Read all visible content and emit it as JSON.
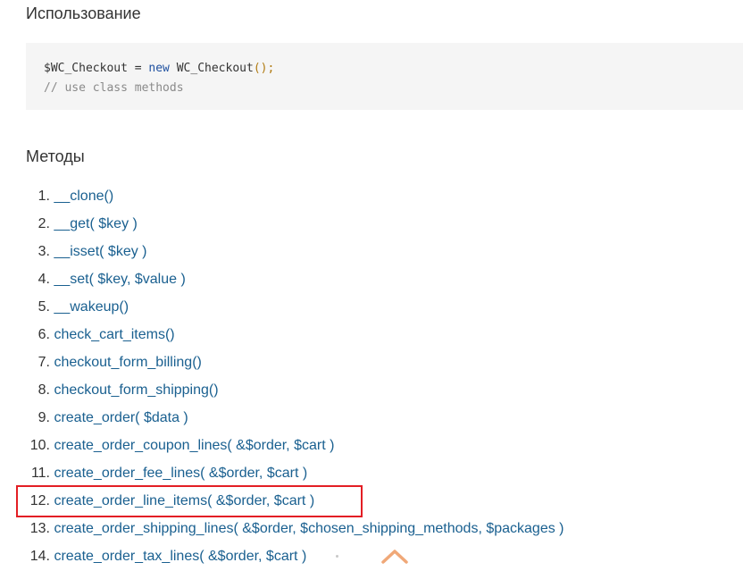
{
  "usage": {
    "title": "Использование",
    "code": {
      "line1": {
        "var": "$WC_Checkout",
        "op": " = ",
        "keyword": "new",
        "space": " ",
        "class": "WC_Checkout",
        "parens": "();"
      },
      "line2": "// use class methods"
    }
  },
  "methods": {
    "title": "Методы",
    "items": [
      {
        "num": "1.",
        "label": "__clone()"
      },
      {
        "num": "2.",
        "label": "__get( $key )"
      },
      {
        "num": "3.",
        "label": "__isset( $key )"
      },
      {
        "num": "4.",
        "label": "__set( $key, $value )"
      },
      {
        "num": "5.",
        "label": "__wakeup()"
      },
      {
        "num": "6.",
        "label": "check_cart_items()"
      },
      {
        "num": "7.",
        "label": "checkout_form_billing()"
      },
      {
        "num": "8.",
        "label": "checkout_form_shipping()"
      },
      {
        "num": "9.",
        "label": "create_order( $data )"
      },
      {
        "num": "10.",
        "label": "create_order_coupon_lines( &$order, $cart )"
      },
      {
        "num": "11.",
        "label": "create_order_fee_lines( &$order, $cart )"
      },
      {
        "num": "12.",
        "label": "create_order_line_items( &$order, $cart )"
      },
      {
        "num": "13.",
        "label": "create_order_shipping_lines( &$order, $chosen_shipping_methods, $packages )"
      },
      {
        "num": "14.",
        "label": "create_order_tax_lines( &$order, $cart )"
      }
    ],
    "highlighted_index": 11
  },
  "colors": {
    "link": "#1a6090",
    "highlight_border": "#e31e24",
    "code_background": "#f5f5f5",
    "scroll_top_arrow": "#f0a878"
  },
  "icons": {
    "scroll_top": "chevron-up-icon"
  }
}
